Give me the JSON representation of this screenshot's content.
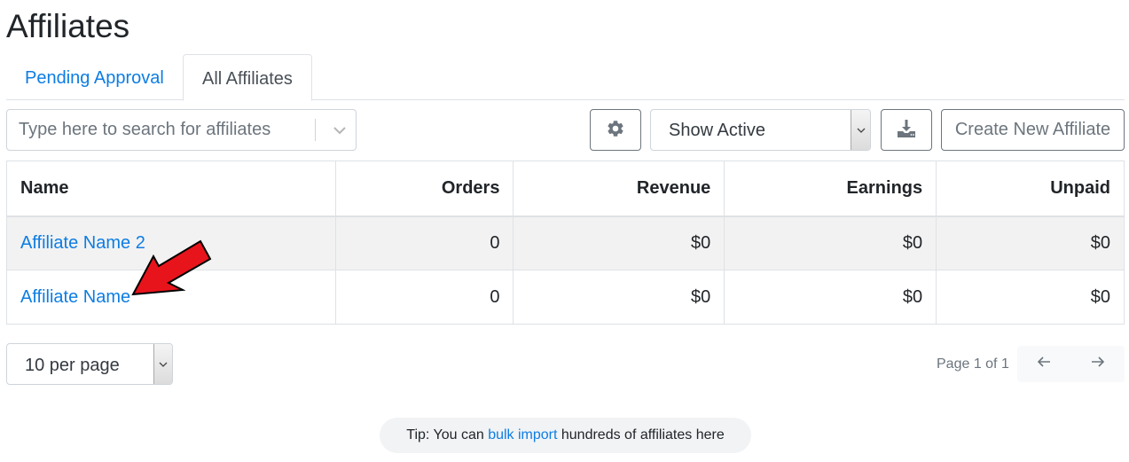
{
  "page": {
    "title": "Affiliates"
  },
  "tabs": [
    {
      "label": "Pending Approval",
      "active": false
    },
    {
      "label": "All Affiliates",
      "active": true
    }
  ],
  "toolbar": {
    "search_placeholder": "Type here to search for affiliates",
    "search_value": "",
    "status_filter": "Show Active",
    "create_label": "Create New Affiliate",
    "settings_icon": "gear-icon",
    "download_icon": "download-icon"
  },
  "table": {
    "columns": [
      "Name",
      "Orders",
      "Revenue",
      "Earnings",
      "Unpaid"
    ],
    "rows": [
      {
        "name": "Affiliate Name 2",
        "orders": "0",
        "revenue": "$0",
        "earnings": "$0",
        "unpaid": "$0"
      },
      {
        "name": "Affiliate Name",
        "orders": "0",
        "revenue": "$0",
        "earnings": "$0",
        "unpaid": "$0"
      }
    ]
  },
  "pagination": {
    "per_page": "10 per page",
    "page_info": "Page 1 of 1"
  },
  "tip": {
    "prefix": "Tip: You can ",
    "link": "bulk import",
    "suffix": " hundreds of affiliates here"
  },
  "colors": {
    "link": "#0d7de3",
    "annotation_arrow": "#e8141c"
  }
}
